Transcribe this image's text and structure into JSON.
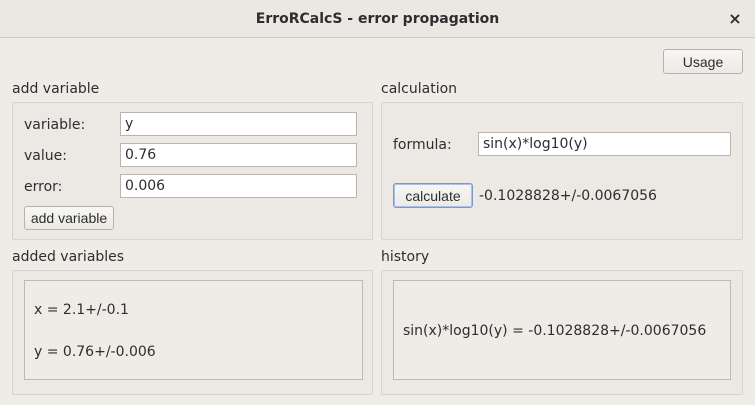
{
  "window": {
    "title": "ErroRCalcS - error propagation",
    "close_glyph": "×"
  },
  "toolbar": {
    "usage_label": "Usage"
  },
  "add_variable": {
    "section_label": "add variable",
    "variable_label": "variable:",
    "variable_value": "y",
    "value_label": "value:",
    "value_value": "0.76",
    "error_label": "error:",
    "error_value": "0.006",
    "button_label": "add variable"
  },
  "calculation": {
    "section_label": "calculation",
    "formula_label": "formula:",
    "formula_value": "sin(x)*log10(y)",
    "button_label": "calculate",
    "result": "-0.1028828+/-0.0067056"
  },
  "added_variables": {
    "section_label": "added variables",
    "items": [
      "x = 2.1+/-0.1",
      "y = 0.76+/-0.006"
    ]
  },
  "history": {
    "section_label": "history",
    "items": [
      "sin(x)*log10(y) = -0.1028828+/-0.0067056"
    ]
  }
}
